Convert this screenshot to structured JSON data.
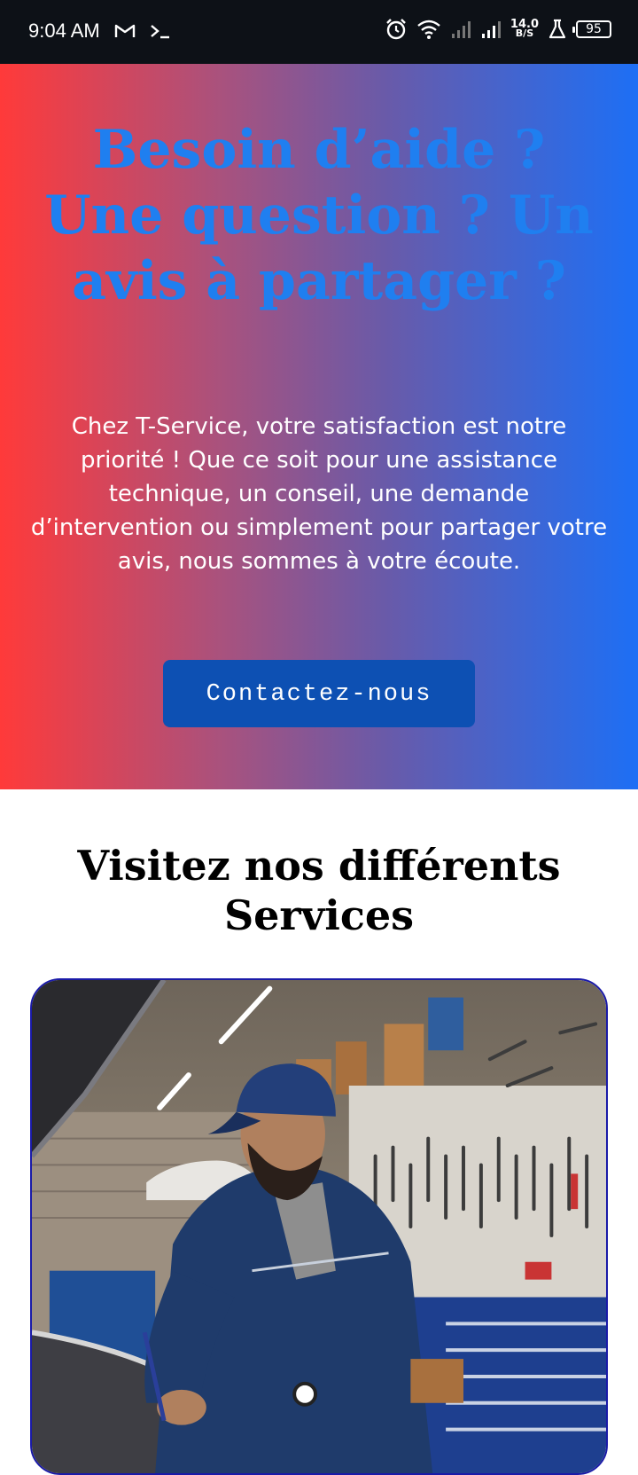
{
  "status_bar": {
    "time": "9:04 AM",
    "gmail_icon": "gmail-icon",
    "terminal_icon": "terminal-icon",
    "net_speed_value": "14.0",
    "net_speed_unit": "B/S",
    "battery_level": "95"
  },
  "hero": {
    "title": "Besoin d’aide ? Une question ? Un avis à partager ?",
    "description": "Chez T-Service, votre satisfaction est notre priorité ! Que ce soit pour une assistance technique, un conseil, une demande d’intervention ou simplement pour partager votre avis, nous sommes à votre écoute.",
    "button_label": "Contactez-nous",
    "colors": {
      "gradient_start": "#ff3a3a",
      "gradient_end": "#1d6ff5",
      "title": "#1f7ff0",
      "button": "#0d50b3"
    }
  },
  "services": {
    "title": "Visitez nos différents Services",
    "card_border_color": "#1a1aa8"
  }
}
